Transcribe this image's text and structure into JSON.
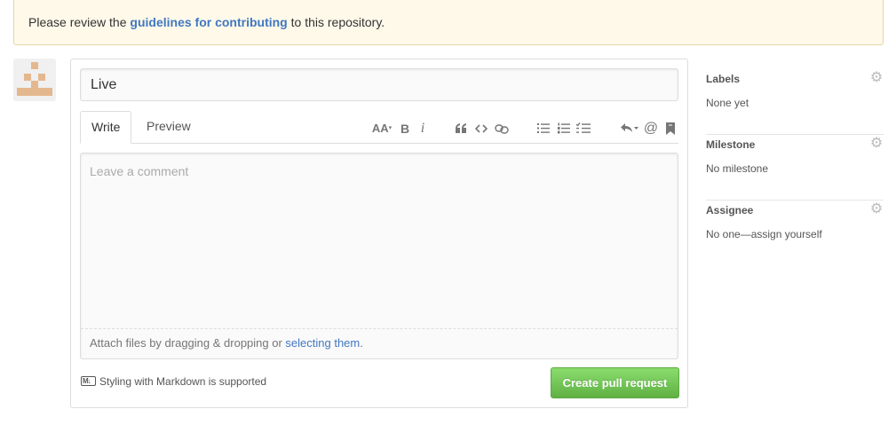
{
  "flash": {
    "prefix": "Please review the ",
    "link": "guidelines for contributing",
    "suffix": " to this repository."
  },
  "compose": {
    "title_value": "Live",
    "tabs": [
      {
        "label": "Write",
        "selected": true
      },
      {
        "label": "Preview",
        "selected": false
      }
    ],
    "toolbar": {
      "text_size_label": "AA",
      "bold_label": "B",
      "italic_label": "i",
      "quote_icon": "quote-icon",
      "code_icon": "code-icon",
      "link_icon": "link-icon",
      "unordered_list_icon": "unordered-list-icon",
      "ordered_list_icon": "ordered-list-icon",
      "task_list_icon": "task-list-icon",
      "reply_icon": "reply-icon",
      "mention_label": "@",
      "saved_replies_icon": "bookmark-icon"
    },
    "comment_placeholder": "Leave a comment",
    "attach_prefix": "Attach files by dragging & dropping or ",
    "attach_link": "selecting them",
    "attach_suffix": ".",
    "markdown_note": "Styling with Markdown is supported",
    "submit_label": "Create pull request",
    "submit_color": "#6cc644",
    "link_color": "#4078c0"
  },
  "sidebar": {
    "sections": [
      {
        "heading": "Labels",
        "value": "None yet"
      },
      {
        "heading": "Milestone",
        "value": "No milestone"
      },
      {
        "heading": "Assignee",
        "value": "No one—assign yourself"
      }
    ]
  }
}
